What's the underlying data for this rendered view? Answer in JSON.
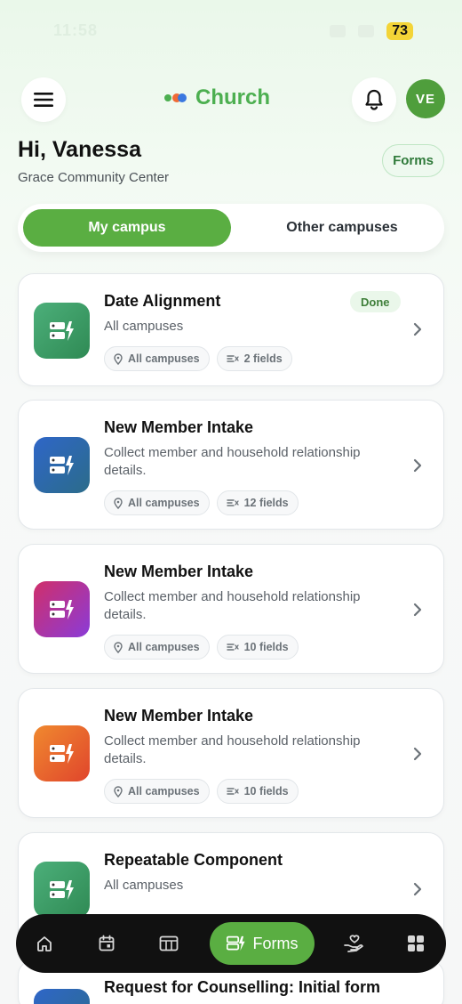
{
  "status": {
    "time": "11:58",
    "battery": "73"
  },
  "header": {
    "brand": "Church",
    "avatar_initials": "VE"
  },
  "greeting": {
    "title": "Hi, Vanessa",
    "org": "Grace Community Center",
    "forms_badge": "Forms"
  },
  "segments": {
    "active": "My campus",
    "inactive": "Other campuses"
  },
  "cards": [
    {
      "title": "Date Alignment",
      "desc": "All campuses",
      "badge": "Done",
      "location": "All campuses",
      "fields": "2 fields",
      "color": "#3e9a62"
    },
    {
      "title": "New Member Intake",
      "desc": "Collect member and household relationship details.",
      "location": "All campuses",
      "fields": "12 fields",
      "color": "#2e5fb8"
    },
    {
      "title": "New Member Intake",
      "desc": "Collect member and household relationship details.",
      "location": "All campuses",
      "fields": "10 fields",
      "color": "#b8338f"
    },
    {
      "title": "New Member Intake",
      "desc": "Collect member and household relationship details.",
      "location": "All campuses",
      "fields": "10 fields",
      "color": "#e86a34"
    },
    {
      "title": "Repeatable Component",
      "desc": "All campuses",
      "color": "#3e9a62"
    },
    {
      "title": "Request for Counselling: Initial form",
      "color": "#2e5fb8"
    }
  ],
  "nav": {
    "active_label": "Forms"
  },
  "colors": {
    "accent": "#5aae42",
    "brand_text": "#4caf50"
  }
}
